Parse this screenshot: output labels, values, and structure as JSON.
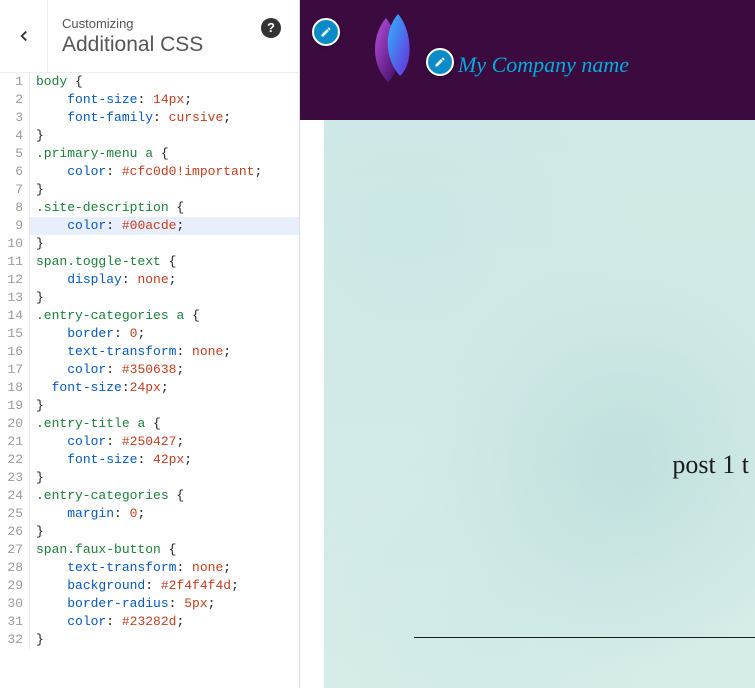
{
  "panel": {
    "breadcrumb": "Customizing",
    "heading": "Additional CSS",
    "help_glyph": "?"
  },
  "editor": {
    "highlighted_line": 9,
    "lines": [
      [
        {
          "c": "t-tag",
          "t": "body"
        },
        {
          "c": "t-punct",
          "t": " {"
        }
      ],
      [
        {
          "c": "t-punct",
          "t": "    "
        },
        {
          "c": "t-prop",
          "t": "font-size"
        },
        {
          "c": "t-punct",
          "t": ": "
        },
        {
          "c": "t-value",
          "t": "14px"
        },
        {
          "c": "t-punct",
          "t": ";"
        }
      ],
      [
        {
          "c": "t-punct",
          "t": "    "
        },
        {
          "c": "t-prop",
          "t": "font-family"
        },
        {
          "c": "t-punct",
          "t": ": "
        },
        {
          "c": "t-value",
          "t": "cursive"
        },
        {
          "c": "t-punct",
          "t": ";"
        }
      ],
      [
        {
          "c": "t-punct",
          "t": "}"
        }
      ],
      [
        {
          "c": "t-class",
          "t": ".primary-menu"
        },
        {
          "c": "t-punct",
          "t": " "
        },
        {
          "c": "t-tag",
          "t": "a"
        },
        {
          "c": "t-punct",
          "t": " {"
        }
      ],
      [
        {
          "c": "t-punct",
          "t": "    "
        },
        {
          "c": "t-prop",
          "t": "color"
        },
        {
          "c": "t-punct",
          "t": ": "
        },
        {
          "c": "t-value",
          "t": "#cfc0d0"
        },
        {
          "c": "t-value",
          "t": "!important"
        },
        {
          "c": "t-punct",
          "t": ";"
        }
      ],
      [
        {
          "c": "t-punct",
          "t": "}"
        }
      ],
      [
        {
          "c": "t-class",
          "t": ".site-description"
        },
        {
          "c": "t-punct",
          "t": " {"
        }
      ],
      [
        {
          "c": "t-punct",
          "t": "    "
        },
        {
          "c": "t-prop",
          "t": "color"
        },
        {
          "c": "t-punct",
          "t": ": "
        },
        {
          "c": "t-value",
          "t": "#00acde"
        },
        {
          "c": "t-punct",
          "t": ";"
        }
      ],
      [
        {
          "c": "t-punct",
          "t": "}"
        }
      ],
      [
        {
          "c": "t-tag",
          "t": "span"
        },
        {
          "c": "t-class",
          "t": ".toggle-text"
        },
        {
          "c": "t-punct",
          "t": " {"
        }
      ],
      [
        {
          "c": "t-punct",
          "t": "    "
        },
        {
          "c": "t-prop",
          "t": "display"
        },
        {
          "c": "t-punct",
          "t": ": "
        },
        {
          "c": "t-value",
          "t": "none"
        },
        {
          "c": "t-punct",
          "t": ";"
        }
      ],
      [
        {
          "c": "t-punct",
          "t": "}"
        }
      ],
      [
        {
          "c": "t-class",
          "t": ".entry-categories"
        },
        {
          "c": "t-punct",
          "t": " "
        },
        {
          "c": "t-tag",
          "t": "a"
        },
        {
          "c": "t-punct",
          "t": " {"
        }
      ],
      [
        {
          "c": "t-punct",
          "t": "    "
        },
        {
          "c": "t-prop",
          "t": "border"
        },
        {
          "c": "t-punct",
          "t": ": "
        },
        {
          "c": "t-value",
          "t": "0"
        },
        {
          "c": "t-punct",
          "t": ";"
        }
      ],
      [
        {
          "c": "t-punct",
          "t": "    "
        },
        {
          "c": "t-prop",
          "t": "text-transform"
        },
        {
          "c": "t-punct",
          "t": ": "
        },
        {
          "c": "t-value",
          "t": "none"
        },
        {
          "c": "t-punct",
          "t": ";"
        }
      ],
      [
        {
          "c": "t-punct",
          "t": "    "
        },
        {
          "c": "t-prop",
          "t": "color"
        },
        {
          "c": "t-punct",
          "t": ": "
        },
        {
          "c": "t-value",
          "t": "#350638"
        },
        {
          "c": "t-punct",
          "t": ";"
        }
      ],
      [
        {
          "c": "t-punct",
          "t": "  "
        },
        {
          "c": "t-prop",
          "t": "font-size"
        },
        {
          "c": "t-punct",
          "t": ":"
        },
        {
          "c": "t-value",
          "t": "24px"
        },
        {
          "c": "t-punct",
          "t": ";"
        }
      ],
      [
        {
          "c": "t-punct",
          "t": "}"
        }
      ],
      [
        {
          "c": "t-class",
          "t": ".entry-title"
        },
        {
          "c": "t-punct",
          "t": " "
        },
        {
          "c": "t-tag",
          "t": "a"
        },
        {
          "c": "t-punct",
          "t": " {"
        }
      ],
      [
        {
          "c": "t-punct",
          "t": "    "
        },
        {
          "c": "t-prop",
          "t": "color"
        },
        {
          "c": "t-punct",
          "t": ": "
        },
        {
          "c": "t-value",
          "t": "#250427"
        },
        {
          "c": "t-punct",
          "t": ";"
        }
      ],
      [
        {
          "c": "t-punct",
          "t": "    "
        },
        {
          "c": "t-prop",
          "t": "font-size"
        },
        {
          "c": "t-punct",
          "t": ": "
        },
        {
          "c": "t-value",
          "t": "42px"
        },
        {
          "c": "t-punct",
          "t": ";"
        }
      ],
      [
        {
          "c": "t-punct",
          "t": "}"
        }
      ],
      [
        {
          "c": "t-class",
          "t": ".entry-categories"
        },
        {
          "c": "t-punct",
          "t": " {"
        }
      ],
      [
        {
          "c": "t-punct",
          "t": "    "
        },
        {
          "c": "t-prop",
          "t": "margin"
        },
        {
          "c": "t-punct",
          "t": ": "
        },
        {
          "c": "t-value",
          "t": "0"
        },
        {
          "c": "t-punct",
          "t": ";"
        }
      ],
      [
        {
          "c": "t-punct",
          "t": "}"
        }
      ],
      [
        {
          "c": "t-tag",
          "t": "span"
        },
        {
          "c": "t-class",
          "t": ".faux-button"
        },
        {
          "c": "t-punct",
          "t": " {"
        }
      ],
      [
        {
          "c": "t-punct",
          "t": "    "
        },
        {
          "c": "t-prop",
          "t": "text-transform"
        },
        {
          "c": "t-punct",
          "t": ": "
        },
        {
          "c": "t-value",
          "t": "none"
        },
        {
          "c": "t-punct",
          "t": ";"
        }
      ],
      [
        {
          "c": "t-punct",
          "t": "    "
        },
        {
          "c": "t-prop",
          "t": "background"
        },
        {
          "c": "t-punct",
          "t": ": "
        },
        {
          "c": "t-value",
          "t": "#2f4f4f4d"
        },
        {
          "c": "t-punct",
          "t": ";"
        }
      ],
      [
        {
          "c": "t-punct",
          "t": "    "
        },
        {
          "c": "t-prop",
          "t": "border-radius"
        },
        {
          "c": "t-punct",
          "t": ": "
        },
        {
          "c": "t-value",
          "t": "5px"
        },
        {
          "c": "t-punct",
          "t": ";"
        }
      ],
      [
        {
          "c": "t-punct",
          "t": "    "
        },
        {
          "c": "t-prop",
          "t": "color"
        },
        {
          "c": "t-punct",
          "t": ": "
        },
        {
          "c": "t-value",
          "t": "#23282d"
        },
        {
          "c": "t-punct",
          "t": ";"
        }
      ],
      [
        {
          "c": "t-punct",
          "t": "}"
        }
      ]
    ]
  },
  "preview": {
    "site_title": "My Company name",
    "post_title": "post 1 t"
  }
}
